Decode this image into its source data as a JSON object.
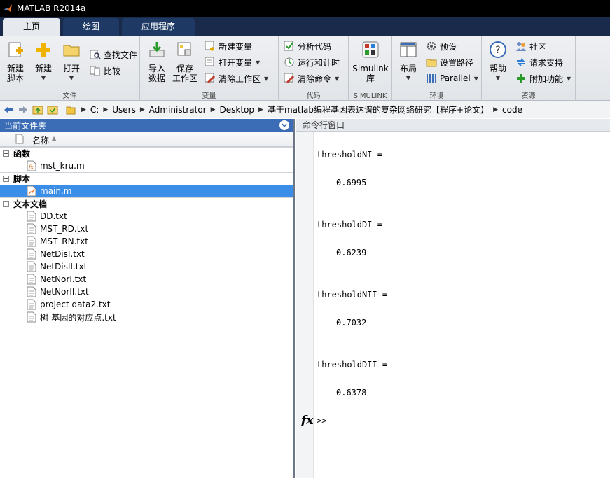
{
  "window": {
    "title": "MATLAB R2014a"
  },
  "tabs": [
    {
      "label": "主页",
      "active": true
    },
    {
      "label": "绘图",
      "active": false
    },
    {
      "label": "应用程序",
      "active": false
    }
  ],
  "ribbon": {
    "file": {
      "caption": "文件",
      "new_script": [
        "新建",
        "脚本"
      ],
      "new": "新建",
      "open": "打开",
      "find_files": "查找文件",
      "compare": "比较"
    },
    "variable": {
      "caption": "变量",
      "import": [
        "导入",
        "数据"
      ],
      "save": [
        "保存",
        "工作区"
      ],
      "new_variable": "新建变量",
      "open_variable": "打开变量",
      "clear_workspace": "清除工作区"
    },
    "code": {
      "caption": "代码",
      "analyze": "分析代码",
      "run_time": "运行和计时",
      "clear_commands": "清除命令"
    },
    "simulink": {
      "caption": "SIMULINK",
      "lib": [
        "Simulink",
        "库"
      ]
    },
    "environment": {
      "caption": "环境",
      "layout": "布局",
      "preferences": "预设",
      "set_path": "设置路径",
      "parallel": "Parallel"
    },
    "resources": {
      "caption": "资源",
      "help": "帮助",
      "community": "社区",
      "request_support": "请求支持",
      "addons": "附加功能"
    }
  },
  "address": {
    "crumbs": [
      "C:",
      "Users",
      "Administrator",
      "Desktop",
      "基于matlab编程基因表达谱的复杂网络研究【程序+论文】",
      "code"
    ]
  },
  "file_panel": {
    "title": "当前文件夹",
    "column_name": "名称",
    "groups": [
      {
        "label": "函数",
        "items": [
          "mst_kru.m"
        ]
      },
      {
        "label": "脚本",
        "items": [
          "main.m"
        ]
      },
      {
        "label": "文本文档",
        "items": [
          "DD.txt",
          "MST_RD.txt",
          "MST_RN.txt",
          "NetDisI.txt",
          "NetDisII.txt",
          "NetNorI.txt",
          "NetNorII.txt",
          "project data2.txt",
          "树-基因的对应点.txt"
        ]
      }
    ],
    "selected": "main.m"
  },
  "command_window": {
    "title": "命令行窗口",
    "outputs": [
      {
        "name": "thresholdNI =",
        "value": "0.6995"
      },
      {
        "name": "thresholdDI =",
        "value": "0.6239"
      },
      {
        "name": "thresholdNII =",
        "value": "0.7032"
      },
      {
        "name": "thresholdDII =",
        "value": "0.6378"
      }
    ],
    "fx": "fx",
    "prompt": ">>"
  },
  "colors": {
    "titlebar": "#000000",
    "tabstrip": "#1a2a4a",
    "panel_header": "#3b6cb6",
    "selection": "#3b8ee8"
  }
}
